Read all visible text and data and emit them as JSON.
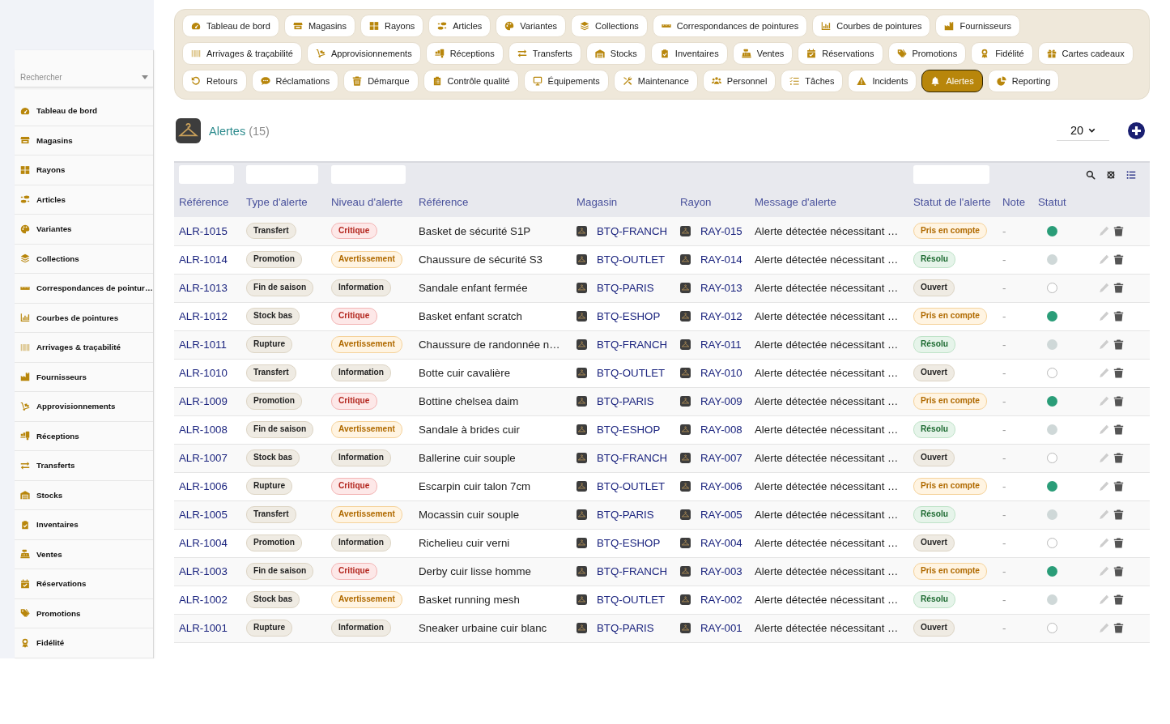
{
  "sidebar": {
    "search": {
      "placeholder": "Rechercher"
    },
    "items": [
      {
        "label": "Tableau de bord",
        "selected": false
      },
      {
        "label": "Magasins",
        "selected": false
      },
      {
        "label": "Rayons",
        "selected": false
      },
      {
        "label": "Articles",
        "selected": false
      },
      {
        "label": "Variantes",
        "selected": false
      },
      {
        "label": "Collections",
        "selected": false
      },
      {
        "label": "Correspondances de pointur…",
        "selected": false
      },
      {
        "label": "Courbes de pointures",
        "selected": false
      },
      {
        "label": "Arrivages & traçabilité",
        "selected": false
      },
      {
        "label": "Fournisseurs",
        "selected": false
      },
      {
        "label": "Approvisionnements",
        "selected": false
      },
      {
        "label": "Réceptions",
        "selected": false
      },
      {
        "label": "Transferts",
        "selected": false
      },
      {
        "label": "Stocks",
        "selected": false
      },
      {
        "label": "Inventaires",
        "selected": false
      },
      {
        "label": "Ventes",
        "selected": false
      },
      {
        "label": "Réservations",
        "selected": false
      },
      {
        "label": "Promotions",
        "selected": false
      },
      {
        "label": "Fidélité",
        "selected": false
      }
    ]
  },
  "nav": {
    "items": [
      {
        "label": "Tableau de bord",
        "selected": false
      },
      {
        "label": "Magasins",
        "selected": false
      },
      {
        "label": "Rayons",
        "selected": false
      },
      {
        "label": "Articles",
        "selected": false
      },
      {
        "label": "Variantes",
        "selected": false
      },
      {
        "label": "Collections",
        "selected": false
      },
      {
        "label": "Correspondances de pointures",
        "selected": false
      },
      {
        "label": "Courbes de pointures",
        "selected": false
      },
      {
        "label": "Fournisseurs",
        "selected": false
      },
      {
        "label": "Arrivages & traçabilité",
        "selected": false
      },
      {
        "label": "Approvisionnements",
        "selected": false
      },
      {
        "label": "Réceptions",
        "selected": false
      },
      {
        "label": "Transferts",
        "selected": false
      },
      {
        "label": "Stocks",
        "selected": false
      },
      {
        "label": "Inventaires",
        "selected": false
      },
      {
        "label": "Ventes",
        "selected": false
      },
      {
        "label": "Réservations",
        "selected": false
      },
      {
        "label": "Promotions",
        "selected": false
      },
      {
        "label": "Fidélité",
        "selected": false
      },
      {
        "label": "Cartes cadeaux",
        "selected": false
      },
      {
        "label": "Retours",
        "selected": false
      },
      {
        "label": "Réclamations",
        "selected": false
      },
      {
        "label": "Démarque",
        "selected": false
      },
      {
        "label": "Contrôle qualité",
        "selected": false
      },
      {
        "label": "Équipements",
        "selected": false
      },
      {
        "label": "Maintenance",
        "selected": false
      },
      {
        "label": "Personnel",
        "selected": false
      },
      {
        "label": "Tâches",
        "selected": false
      },
      {
        "label": "Incidents",
        "selected": false
      },
      {
        "label": "Alertes",
        "selected": true
      },
      {
        "label": "Reporting",
        "selected": false
      }
    ]
  },
  "header": {
    "title": "Alertes",
    "count": "(15)",
    "page_size": "20"
  },
  "table": {
    "columns": [
      {
        "label": "Référence",
        "filter": true
      },
      {
        "label": "Type d'alerte",
        "filter": true
      },
      {
        "label": "Niveau d'alerte",
        "filter": true
      },
      {
        "label": "Référence",
        "filter": false
      },
      {
        "label": "Magasin",
        "filter": false
      },
      {
        "label": "Rayon",
        "filter": false
      },
      {
        "label": "Message d'alerte",
        "filter": false
      },
      {
        "label": "Statut de l'alerte",
        "filter": true
      },
      {
        "label": "Note",
        "filter": false
      },
      {
        "label": "Statut",
        "filter": false
      }
    ],
    "rows": [
      {
        "reference": "ALR-1015",
        "type": "Transfert",
        "niveau": {
          "label": "Critique",
          "kind": "critical"
        },
        "article": "Basket de sécurité S1P",
        "magasin": "BTQ-FRANCH",
        "rayon": "RAY-015",
        "message": "Alerte détectée nécessitant …",
        "statut_alerte": {
          "label": "Pris en compte",
          "kind": "warning"
        },
        "note": "-",
        "statut": {
          "kind": "active"
        }
      },
      {
        "reference": "ALR-1014",
        "type": "Promotion",
        "niveau": {
          "label": "Avertissement",
          "kind": "warning"
        },
        "article": "Chaussure de sécurité S3",
        "magasin": "BTQ-OUTLET",
        "rayon": "RAY-014",
        "message": "Alerte détectée nécessitant …",
        "statut_alerte": {
          "label": "Résolu",
          "kind": "success"
        },
        "note": "-",
        "statut": {
          "kind": "inactive"
        }
      },
      {
        "reference": "ALR-1013",
        "type": "Fin de saison",
        "niveau": {
          "label": "Information",
          "kind": "neutral"
        },
        "article": "Sandale enfant fermée",
        "magasin": "BTQ-PARIS",
        "rayon": "RAY-013",
        "message": "Alerte détectée nécessitant …",
        "statut_alerte": {
          "label": "Ouvert",
          "kind": "neutral"
        },
        "note": "-",
        "statut": {
          "kind": "empty"
        }
      },
      {
        "reference": "ALR-1012",
        "type": "Stock bas",
        "niveau": {
          "label": "Critique",
          "kind": "critical"
        },
        "article": "Basket enfant scratch",
        "magasin": "BTQ-ESHOP",
        "rayon": "RAY-012",
        "message": "Alerte détectée nécessitant …",
        "statut_alerte": {
          "label": "Pris en compte",
          "kind": "warning"
        },
        "note": "-",
        "statut": {
          "kind": "active"
        }
      },
      {
        "reference": "ALR-1011",
        "type": "Rupture",
        "niveau": {
          "label": "Avertissement",
          "kind": "warning"
        },
        "article": "Chaussure de randonnée n…",
        "magasin": "BTQ-FRANCH",
        "rayon": "RAY-011",
        "message": "Alerte détectée nécessitant …",
        "statut_alerte": {
          "label": "Résolu",
          "kind": "success"
        },
        "note": "-",
        "statut": {
          "kind": "inactive"
        }
      },
      {
        "reference": "ALR-1010",
        "type": "Transfert",
        "niveau": {
          "label": "Information",
          "kind": "neutral"
        },
        "article": "Botte cuir cavalière",
        "magasin": "BTQ-OUTLET",
        "rayon": "RAY-010",
        "message": "Alerte détectée nécessitant …",
        "statut_alerte": {
          "label": "Ouvert",
          "kind": "neutral"
        },
        "note": "-",
        "statut": {
          "kind": "empty"
        }
      },
      {
        "reference": "ALR-1009",
        "type": "Promotion",
        "niveau": {
          "label": "Critique",
          "kind": "critical"
        },
        "article": "Bottine chelsea daim",
        "magasin": "BTQ-PARIS",
        "rayon": "RAY-009",
        "message": "Alerte détectée nécessitant …",
        "statut_alerte": {
          "label": "Pris en compte",
          "kind": "warning"
        },
        "note": "-",
        "statut": {
          "kind": "active"
        }
      },
      {
        "reference": "ALR-1008",
        "type": "Fin de saison",
        "niveau": {
          "label": "Avertissement",
          "kind": "warning"
        },
        "article": "Sandale à brides cuir",
        "magasin": "BTQ-ESHOP",
        "rayon": "RAY-008",
        "message": "Alerte détectée nécessitant …",
        "statut_alerte": {
          "label": "Résolu",
          "kind": "success"
        },
        "note": "-",
        "statut": {
          "kind": "inactive"
        }
      },
      {
        "reference": "ALR-1007",
        "type": "Stock bas",
        "niveau": {
          "label": "Information",
          "kind": "neutral"
        },
        "article": "Ballerine cuir souple",
        "magasin": "BTQ-FRANCH",
        "rayon": "RAY-007",
        "message": "Alerte détectée nécessitant …",
        "statut_alerte": {
          "label": "Ouvert",
          "kind": "neutral"
        },
        "note": "-",
        "statut": {
          "kind": "empty"
        }
      },
      {
        "reference": "ALR-1006",
        "type": "Rupture",
        "niveau": {
          "label": "Critique",
          "kind": "critical"
        },
        "article": "Escarpin cuir talon 7cm",
        "magasin": "BTQ-OUTLET",
        "rayon": "RAY-006",
        "message": "Alerte détectée nécessitant …",
        "statut_alerte": {
          "label": "Pris en compte",
          "kind": "warning"
        },
        "note": "-",
        "statut": {
          "kind": "active"
        }
      },
      {
        "reference": "ALR-1005",
        "type": "Transfert",
        "niveau": {
          "label": "Avertissement",
          "kind": "warning"
        },
        "article": "Mocassin cuir souple",
        "magasin": "BTQ-PARIS",
        "rayon": "RAY-005",
        "message": "Alerte détectée nécessitant …",
        "statut_alerte": {
          "label": "Résolu",
          "kind": "success"
        },
        "note": "-",
        "statut": {
          "kind": "inactive"
        }
      },
      {
        "reference": "ALR-1004",
        "type": "Promotion",
        "niveau": {
          "label": "Information",
          "kind": "neutral"
        },
        "article": "Richelieu cuir verni",
        "magasin": "BTQ-ESHOP",
        "rayon": "RAY-004",
        "message": "Alerte détectée nécessitant …",
        "statut_alerte": {
          "label": "Ouvert",
          "kind": "neutral"
        },
        "note": "-",
        "statut": {
          "kind": "empty"
        }
      },
      {
        "reference": "ALR-1003",
        "type": "Fin de saison",
        "niveau": {
          "label": "Critique",
          "kind": "critical"
        },
        "article": "Derby cuir lisse homme",
        "magasin": "BTQ-FRANCH",
        "rayon": "RAY-003",
        "message": "Alerte détectée nécessitant …",
        "statut_alerte": {
          "label": "Pris en compte",
          "kind": "warning"
        },
        "note": "-",
        "statut": {
          "kind": "active"
        }
      },
      {
        "reference": "ALR-1002",
        "type": "Stock bas",
        "niveau": {
          "label": "Avertissement",
          "kind": "warning"
        },
        "article": "Basket running mesh",
        "magasin": "BTQ-OUTLET",
        "rayon": "RAY-002",
        "message": "Alerte détectée nécessitant …",
        "statut_alerte": {
          "label": "Résolu",
          "kind": "success"
        },
        "note": "-",
        "statut": {
          "kind": "inactive"
        }
      },
      {
        "reference": "ALR-1001",
        "type": "Rupture",
        "niveau": {
          "label": "Information",
          "kind": "neutral"
        },
        "article": "Sneaker urbaine cuir blanc",
        "magasin": "BTQ-PARIS",
        "rayon": "RAY-001",
        "message": "Alerte détectée nécessitant …",
        "statut_alerte": {
          "label": "Ouvert",
          "kind": "neutral"
        },
        "note": "-",
        "statut": {
          "kind": "empty"
        }
      }
    ]
  }
}
